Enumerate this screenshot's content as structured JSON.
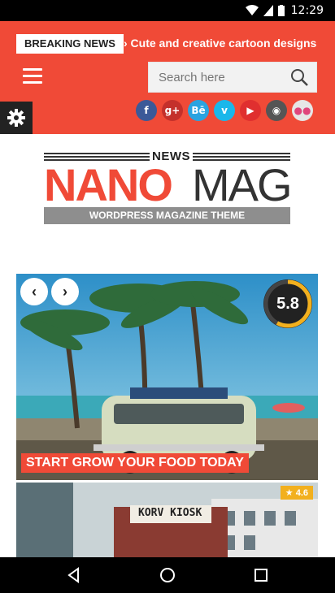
{
  "status_bar": {
    "time": "12:29"
  },
  "header": {
    "breaking_label": "BREAKING NEWS",
    "ticker_text": "› Cute and creative cartoon designs",
    "search_placeholder": "Search here",
    "social": [
      {
        "name": "facebook-icon",
        "glyph": "f",
        "color": "#3b5998"
      },
      {
        "name": "googleplus-icon",
        "glyph": "g+",
        "color": "#c4302b"
      },
      {
        "name": "behance-icon",
        "glyph": "Bē",
        "color": "#2aa3e0"
      },
      {
        "name": "vimeo-icon",
        "glyph": "v",
        "color": "#1ab7ea"
      },
      {
        "name": "youtube-icon",
        "glyph": "▶",
        "color": "#e02f2f"
      },
      {
        "name": "instagram-icon",
        "glyph": "◉",
        "color": "#555555"
      },
      {
        "name": "flickr-icon",
        "glyph": "●●",
        "color": "#e6e6e6"
      }
    ]
  },
  "logo": {
    "news": "NEWS",
    "nano": "NANO",
    "mag": "MAG",
    "tagline": "WORDPRESS MAGAZINE THEME"
  },
  "slider": {
    "score": "5.8",
    "title": "START GROW YOUR FOOD TODAY",
    "prev_glyph": "‹",
    "next_glyph": "›"
  },
  "card2": {
    "rating": "★ 4.6",
    "sign": "KORV KIOSK"
  },
  "colors": {
    "accent": "#f04a37",
    "dark": "#222222",
    "score_ring": "#f2b01e"
  }
}
